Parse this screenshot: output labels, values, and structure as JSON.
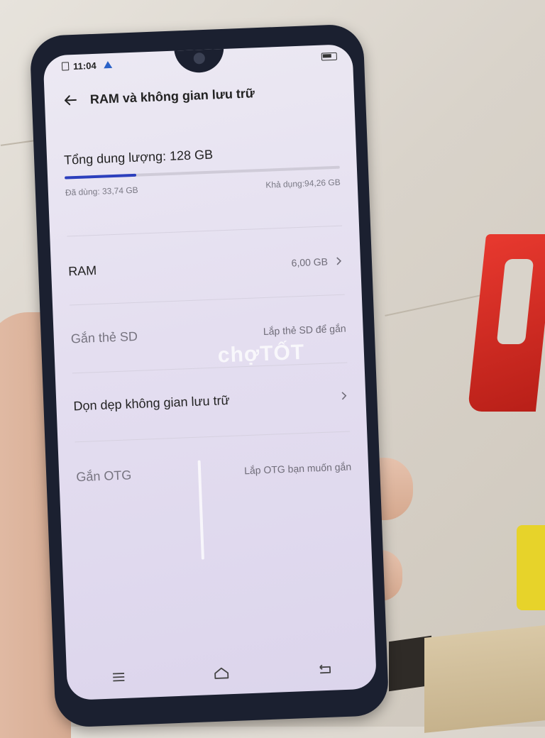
{
  "status_bar": {
    "time": "11:04"
  },
  "header": {
    "title": "RAM và không gian lưu trữ"
  },
  "storage": {
    "total_label": "Tổng dung lượng: 128 GB",
    "used_label": "Đã dùng: 33,74 GB",
    "available_label": "Khả dụng:94,26 GB",
    "used_fraction": 0.26
  },
  "settings": [
    {
      "label": "RAM",
      "value": "6,00 GB"
    },
    {
      "label": "Gắn thẻ SD",
      "value": "Lắp thẻ SD để gắn"
    },
    {
      "label": "Dọn dẹp không gian lưu trữ",
      "value": ""
    },
    {
      "label": "Gắn OTG",
      "value": "Lắp OTG bạn muốn gắn"
    }
  ],
  "watermark": "chợTỐT",
  "colors": {
    "accent": "#2c3fbd",
    "alert": "#2b62c8"
  }
}
